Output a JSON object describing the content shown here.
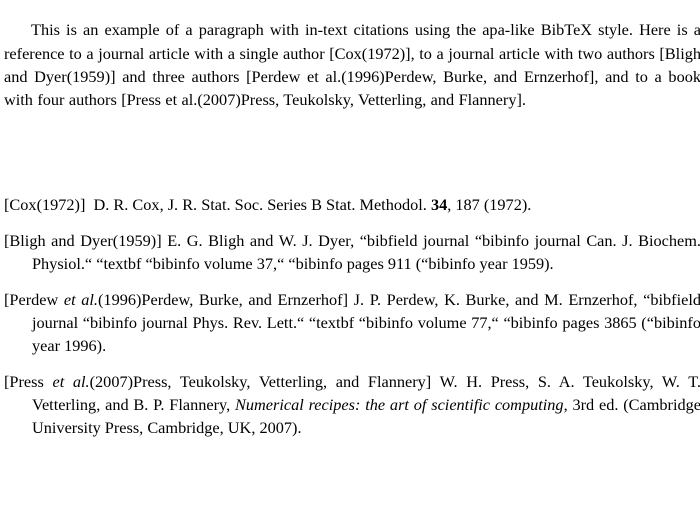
{
  "document": {
    "background_color": "#ffffff",
    "text_color": "#000000",
    "intro": {
      "text": "This is an example of a paragraph with in-text citations using the apa-like BibTeX style. Here is a reference to a journal article with a single author [Cox(1972)], to a journal article with two authors [Bligh and Dyer(1959)] and three authors [Perdew et al.(1996)Perdew, Burke, and Ernzerhof], and to a book with four authors [Press et al.(2007)Press, Teukolsky, Vetterling, and Flannery]."
    },
    "bibliography": {
      "entries": [
        {
          "id": "cox-1972",
          "key": "[Cox(1972)]",
          "body_before_bold": "D. R. Cox, J. R. Stat. Soc. Series B Stat. Methodol. ",
          "bold": "34",
          "body_after_bold": ", 187 (1972).",
          "full_text": "[Cox(1972)] D. R. Cox, J. R. Stat. Soc. Series B Stat. Methodol. 34, 187 (1972)."
        },
        {
          "id": "bligh-dyer-1959",
          "key": "[Bligh and Dyer(1959)]",
          "body": "E. G. Bligh and W. J. Dyer, “bibfield journal “bibinfo journal Can. J. Biochem. Physiol.“ “textbf “bibinfo volume 37,“ “bibinfo pages 911 (“bibinfo year 1959).",
          "full_text": "[Bligh and Dyer(1959)] E. G. Bligh and W. J. Dyer, “bibfield journal “bibinfo journal Can. J. Biochem. Physiol.“ “textbf “bibinfo volume 37,“ “bibinfo pages 911 (“bibinfo year 1959)."
        },
        {
          "id": "perdew-1996",
          "key_part1": "[Perdew ",
          "key_italic": "et al.",
          "key_part2": "(1996)Perdew, Burke, and Ernzerhof]",
          "body": "J. P. Perdew, K. Burke, and M. Ernzerhof, “bibfield journal “bibinfo journal Phys. Rev. Lett.“ “textbf “bibinfo volume 77,“ “bibinfo pages 3865 (“bibinfo year 1996).",
          "full_text": "[Perdew et al.(1996)Perdew, Burke, and Ernzerhof] J. P. Perdew, K. Burke, and M. Ernzerhof, “bibfield journal “bibinfo journal Phys. Rev. Lett.“ “textbf “bibinfo volume 77,“ “bibinfo pages 3865 (“bibinfo year 1996)."
        },
        {
          "id": "press-2007",
          "key_part1": "[Press ",
          "key_italic": "et al.",
          "key_part2": "(2007)Press, Teukolsky, Vetterling, and Flannery]",
          "body_part1": "W. H. Press, S. A. Teukolsky, W. T. Vetterling,  and B. P. Flannery, ",
          "body_italic": "Numerical recipes: the art of scientific computing",
          "body_part2": ", 3rd ed. (Cambridge University Press, Cambridge, UK, 2007).",
          "full_text": "[Press et al.(2007)Press, Teukolsky, Vetterling, and Flannery] W. H. Press, S. A. Teukolsky, W. T. Vetterling,  and B. P. Flannery, Numerical recipes: the art of scientific computing, 3rd ed. (Cambridge University Press, Cambridge, UK, 2007)."
        }
      ]
    }
  }
}
